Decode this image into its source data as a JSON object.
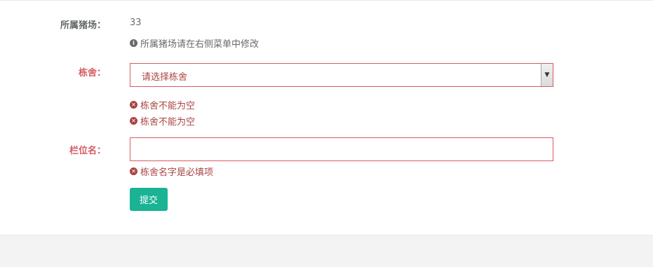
{
  "form": {
    "farm": {
      "label": "所属猪场：",
      "value": "33",
      "help_icon": "info-icon",
      "help": "所属猪场请在右侧菜单中修改"
    },
    "building": {
      "label": "栋舍：",
      "selected": "请选择栋舍",
      "error_icon": "error-icon",
      "errors": [
        "栋舍不能为空",
        "栋舍不能为空"
      ]
    },
    "pen": {
      "label": "栏位名：",
      "value": "",
      "placeholder": "",
      "error_icon": "error-icon",
      "error": "栋舍名字是必填项"
    },
    "submit_label": "提交"
  },
  "colors": {
    "error_label": "#d75b62",
    "error_text": "#a94442",
    "primary": "#1ab394",
    "page_bg": "#f3f3f4"
  }
}
